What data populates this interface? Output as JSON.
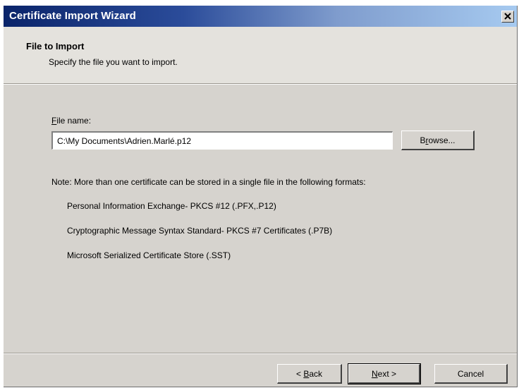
{
  "window": {
    "title": "Certificate Import Wizard"
  },
  "header": {
    "title": "File to Import",
    "subtitle": "Specify the file you want to import."
  },
  "form": {
    "file_label_accel": "F",
    "file_label_rest": "ile name:",
    "file_value": "C:\\My Documents\\Adrien.Marlé.p12",
    "browse_accel": "r",
    "browse_pre": "B",
    "browse_rest": "owse..."
  },
  "note": {
    "text": "Note:  More than one certificate can be stored in a single file in the following formats:",
    "formats": [
      "Personal Information Exchange- PKCS #12 (.PFX,.P12)",
      "Cryptographic Message Syntax Standard- PKCS #7 Certificates (.P7B)",
      "Microsoft Serialized Certificate Store (.SST)"
    ]
  },
  "buttons": {
    "back_pre": "< ",
    "back_accel": "B",
    "back_rest": "ack",
    "next_accel": "N",
    "next_rest": "ext >",
    "cancel": "Cancel"
  },
  "colors": {
    "dialog_bg": "#d6d3ce",
    "title_start": "#0a246a",
    "title_end": "#a6caf0"
  },
  "icons": {
    "close": "close-icon"
  }
}
